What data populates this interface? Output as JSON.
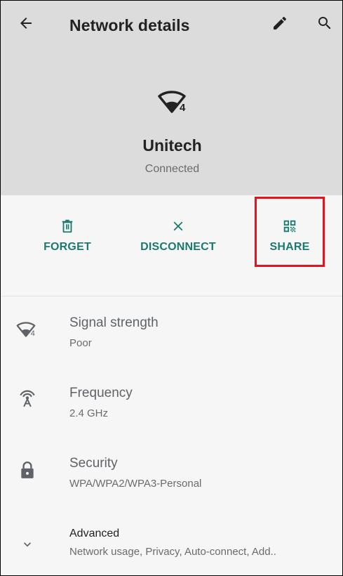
{
  "toolbar": {
    "title": "Network details",
    "back_icon": "arrow-back-icon",
    "edit_icon": "pencil-icon",
    "search_icon": "search-icon"
  },
  "network": {
    "name": "Unitech",
    "status": "Connected",
    "wifi_badge": "4"
  },
  "actions": [
    {
      "label": "FORGET",
      "icon": "trash-icon"
    },
    {
      "label": "DISCONNECT",
      "icon": "close-icon"
    },
    {
      "label": "SHARE",
      "icon": "qr-code-icon"
    }
  ],
  "details": {
    "signal": {
      "title": "Signal strength",
      "value": "Poor",
      "badge": "4"
    },
    "frequency": {
      "title": "Frequency",
      "value": "2.4 GHz"
    },
    "security": {
      "title": "Security",
      "value": "WPA/WPA2/WPA3-Personal"
    },
    "advanced": {
      "title": "Advanced",
      "value": "Network usage, Privacy, Auto-connect, Add.."
    }
  },
  "colors": {
    "header_bg": "#dcdcdc",
    "body_bg": "#f6f6f6",
    "accent": "#1a7a6e",
    "highlight": "#e8121c"
  }
}
